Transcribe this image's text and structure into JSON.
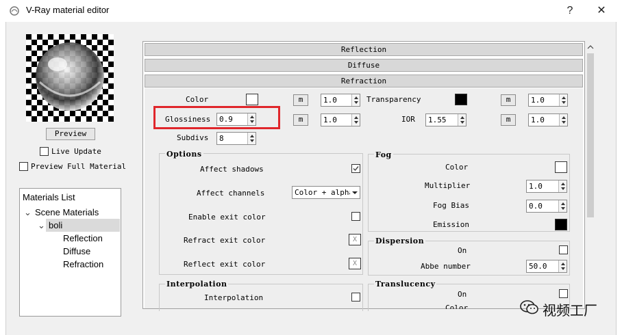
{
  "window": {
    "title": "V-Ray material editor",
    "help_label": "?",
    "close_label": "✕"
  },
  "preview": {
    "button_label": "Preview",
    "live_update_label": "Live Update",
    "live_update_checked": false,
    "full_material_label": "Preview Full Material",
    "full_material_checked": false
  },
  "materials_list": {
    "title": "Materials List",
    "root": "Scene Materials",
    "material": "boli",
    "layers": [
      "Reflection",
      "Diffuse",
      "Refraction"
    ]
  },
  "rollouts": [
    "Reflection",
    "Diffuse",
    "Refraction"
  ],
  "refraction": {
    "color_label": "Color",
    "color_value": "#ffffff",
    "color_m": "m",
    "color_mult": "1.0",
    "transparency_label": "Transparency",
    "transparency_color": "#000000",
    "transparency_m": "m",
    "transparency_mult": "1.0",
    "glossiness_label": "Glossiness",
    "glossiness_value": "0.9",
    "glossiness_m": "m",
    "glossiness_mult": "1.0",
    "ior_label": "IOR",
    "ior_value": "1.55",
    "ior_m": "m",
    "ior_mult": "1.0",
    "subdivs_label": "Subdivs",
    "subdivs_value": "8",
    "highlight_color": "#e0262b"
  },
  "options": {
    "title": "Options",
    "affect_shadows_label": "Affect shadows",
    "affect_shadows_checked": true,
    "affect_channels_label": "Affect channels",
    "affect_channels_value": "Color + alpha",
    "enable_exit_color_label": "Enable exit color",
    "refract_exit_color_label": "Refract exit color",
    "reflect_exit_color_label": "Reflect exit color",
    "exit_mark": "X"
  },
  "fog": {
    "title": "Fog",
    "color_label": "Color",
    "color_value": "#ffffff",
    "multiplier_label": "Multiplier",
    "multiplier_value": "1.0",
    "bias_label": "Fog Bias",
    "bias_value": "0.0",
    "emission_label": "Emission",
    "emission_color": "#000000"
  },
  "dispersion": {
    "title": "Dispersion",
    "on_label": "On",
    "abbe_label": "Abbe number",
    "abbe_value": "50.0"
  },
  "interpolation": {
    "title": "Interpolation",
    "label": "Interpolation"
  },
  "translucency": {
    "title": "Translucency",
    "on_label": "On",
    "color_label": "Color"
  },
  "watermark": {
    "text": "视频工厂"
  }
}
